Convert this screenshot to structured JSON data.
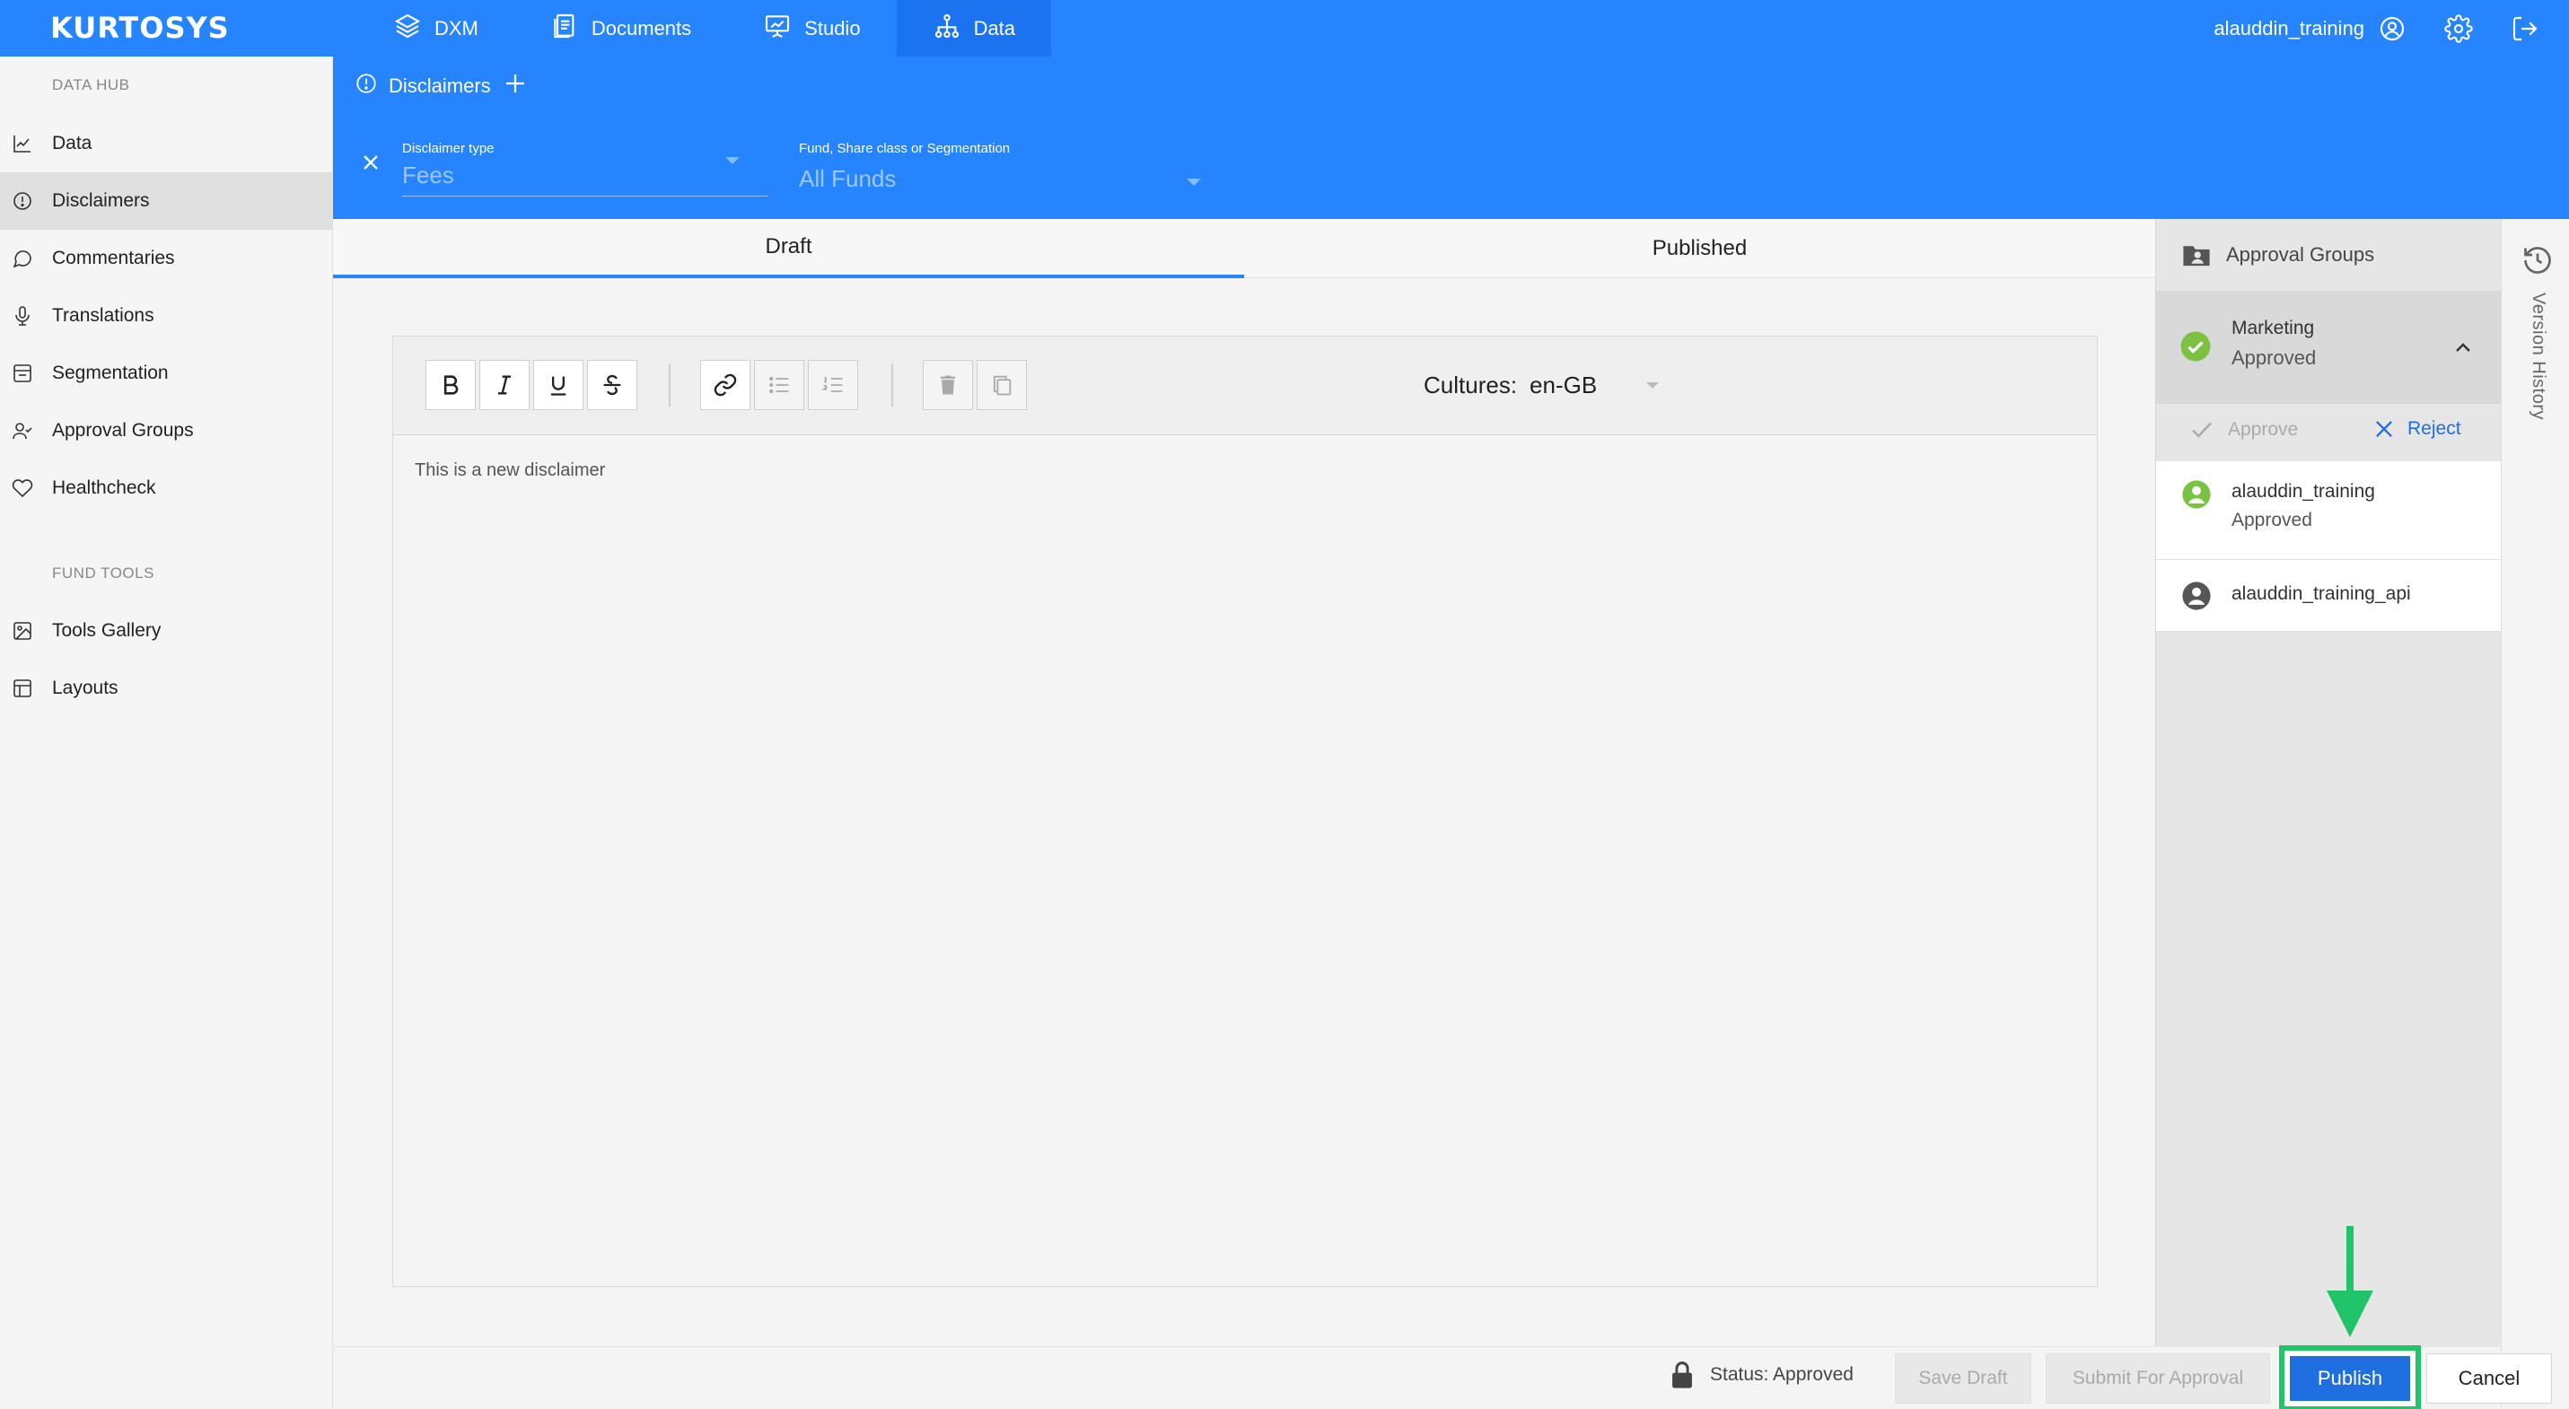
{
  "app": {
    "logo": "KURTOSYS",
    "nav": [
      "DXM",
      "Documents",
      "Studio",
      "Data"
    ],
    "active_nav": "Data",
    "user": "alauddin_training"
  },
  "sidebar": {
    "heading_data_hub": "DATA HUB",
    "items": [
      "Data",
      "Disclaimers",
      "Commentaries",
      "Translations",
      "Segmentation",
      "Approval Groups",
      "Healthcheck"
    ],
    "active_item": "Disclaimers",
    "heading_fund_tools": "FUND TOOLS",
    "tools": [
      "Tools Gallery",
      "Layouts"
    ]
  },
  "header": {
    "title": "Disclaimers",
    "disclaimer_type_label": "Disclaimer type",
    "disclaimer_type_value": "Fees",
    "fund_label": "Fund, Share class or Segmentation",
    "fund_value": "All Funds"
  },
  "tabs": [
    "Draft",
    "Published"
  ],
  "active_tab": "Draft",
  "editor": {
    "cultures_label": "Cultures:",
    "cultures_value": "en-GB",
    "content": "This is a new disclaimer"
  },
  "approval_panel": {
    "title": "Approval Groups",
    "group_name": "Marketing",
    "group_status": "Approved",
    "approve_label": "Approve",
    "reject_label": "Reject",
    "members": [
      {
        "name": "alauddin_training",
        "status": "Approved"
      },
      {
        "name": "alauddin_training_api",
        "status": ""
      }
    ]
  },
  "version_history_label": "Version History",
  "footer": {
    "status": "Status: Approved",
    "save_draft": "Save Draft",
    "submit_for_approval": "Submit For Approval",
    "publish": "Publish",
    "cancel": "Cancel"
  },
  "colors": {
    "brand_blue": "#2684ff",
    "approved_green": "#7cc242",
    "highlight_green": "#22c46a",
    "publish_blue": "#1f6fe0"
  }
}
